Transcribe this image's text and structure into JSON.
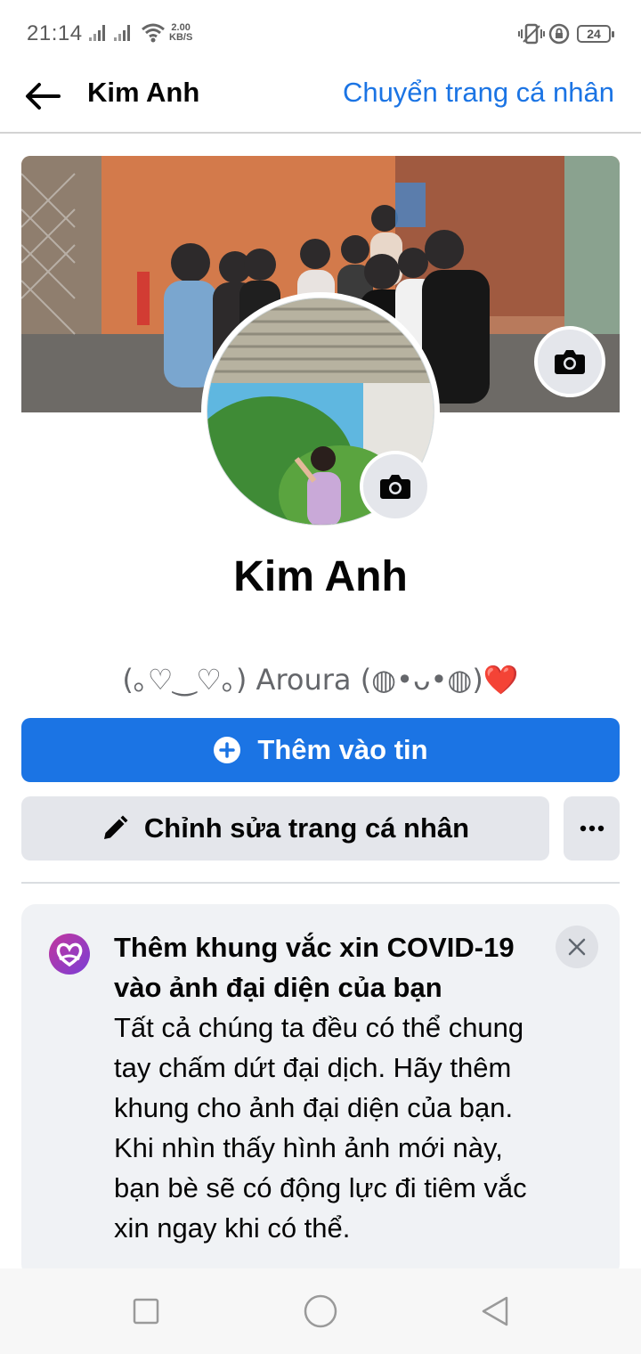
{
  "status_bar": {
    "time": "21:14",
    "net_speed_value": "2.00",
    "net_speed_unit": "KB/S",
    "battery": "24",
    "icons": [
      "signal-icon",
      "signal-icon",
      "wifi-icon",
      "vibrate-icon",
      "rotation-lock-icon",
      "battery-icon"
    ]
  },
  "header": {
    "title": "Kim Anh",
    "switch_link": "Chuyển trang cá nhân",
    "link_color": "#1b74e4"
  },
  "profile": {
    "name": "Kim Anh",
    "bio_text": "(｡♡‿♡｡) Aroura (◍•ᴗ•◍)",
    "bio_emoji": "❤️"
  },
  "actions": {
    "add_story": "Thêm vào tin",
    "edit_profile": "Chỉnh sửa trang cá nhân",
    "more": "more-icon",
    "primary_color": "#1b74e4"
  },
  "promo_card": {
    "title": "Thêm khung vắc xin COVID-19 vào ảnh đại diện của bạn",
    "body": "Tất cả chúng ta đều có thể chung tay chấm dứt đại dịch. Hãy thêm khung cho ảnh đại diện của bạn. Khi nhìn thấy hình ảnh mới này, bạn bè sẽ có động lực đi tiêm vắc xin ngay khi có thể."
  },
  "nav": [
    "recents-icon",
    "home-icon",
    "back-icon"
  ]
}
